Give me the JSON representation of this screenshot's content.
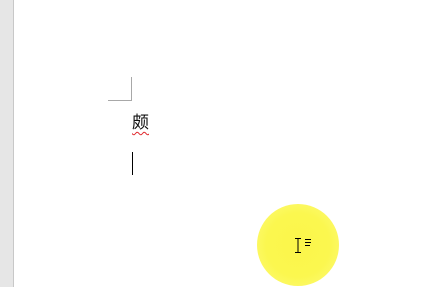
{
  "document": {
    "text": "颇",
    "spelling_flag_color": "#e0262b"
  },
  "cursor": {
    "highlight_color": "#fbf64a",
    "icon": "ibeam-with-text-lines-icon"
  },
  "icons": {
    "margin_mark": "corner-margin-marker-icon"
  }
}
